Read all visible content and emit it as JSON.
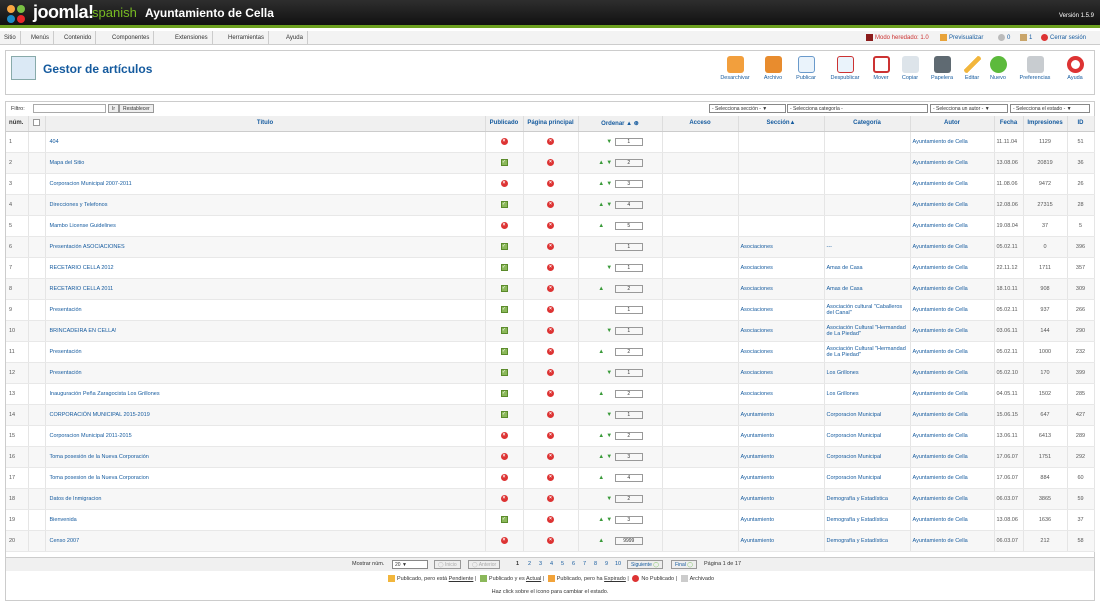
{
  "header": {
    "brand": "joomla!",
    "brand_sub": "spanish",
    "site": "Ayuntamiento de Cella",
    "version": "Versión 1.5.9"
  },
  "menu": [
    "Sitio",
    "Menús",
    "Contenido",
    "Componentes",
    "Extensiones",
    "Herramientas",
    "Ayuda"
  ],
  "status": {
    "legacy": "Modo heredado: 1.0",
    "preview": "Previsualizar",
    "messages": "0",
    "users": "1",
    "logout": "Cerrar sesión"
  },
  "page": {
    "title": "Gestor de artículos"
  },
  "toolbar": [
    "Desarchivar",
    "Archivo",
    "Publicar",
    "Despublicar",
    "Mover",
    "Copiar",
    "Papelera",
    "Editar",
    "Nuevo",
    "Preferencias",
    "Ayuda"
  ],
  "filter": {
    "label": "Filtro:",
    "value": "",
    "go": "Ir",
    "reset": "Restablecer",
    "section": "- Selecciona sección -",
    "category": "- Selecciona categoría -",
    "author": "- Selecciona un autor -",
    "state": "- Selecciona el estado -"
  },
  "columns": [
    "núm.",
    "Título",
    "Publicado",
    "Página principal",
    "Ordenar",
    "Acceso",
    "Sección",
    "Categoría",
    "Autor",
    "Fecha",
    "Impresiones",
    "ID"
  ],
  "rows": [
    {
      "n": "1",
      "t": "404",
      "p": "x",
      "f": "x",
      "up": false,
      "dn": true,
      "o": "1",
      "s": "",
      "c": "",
      "a": "Ayuntamiento de Cella",
      "d": "11.11.04",
      "h": "1129",
      "id": "51"
    },
    {
      "n": "2",
      "t": "Mapa del Sitio",
      "p": "ok",
      "f": "x",
      "up": true,
      "dn": true,
      "o": "2",
      "s": "",
      "c": "",
      "a": "Ayuntamiento de Cella",
      "d": "13.08.06",
      "h": "20819",
      "id": "36"
    },
    {
      "n": "3",
      "t": "Corporacion Municipal 2007-2011",
      "p": "x",
      "f": "x",
      "up": true,
      "dn": true,
      "o": "3",
      "s": "",
      "c": "",
      "a": "Ayuntamiento de Cella",
      "d": "11.08.06",
      "h": "9472",
      "id": "26"
    },
    {
      "n": "4",
      "t": "Direcciones y Telefonos",
      "p": "ok",
      "f": "x",
      "up": true,
      "dn": true,
      "o": "4",
      "s": "",
      "c": "",
      "a": "Ayuntamiento de Cella",
      "d": "12.08.06",
      "h": "27315",
      "id": "28"
    },
    {
      "n": "5",
      "t": "Mambo License Guidelines",
      "p": "x",
      "f": "x",
      "up": true,
      "dn": false,
      "o": "5",
      "s": "",
      "c": "",
      "a": "Ayuntamiento de Cella",
      "d": "19.08.04",
      "h": "37",
      "id": "5"
    },
    {
      "n": "6",
      "t": "Presentación ASOCIACIONES",
      "p": "ok",
      "f": "x",
      "up": false,
      "dn": false,
      "o": "1",
      "s": "Asociaciones",
      "c": "---",
      "a": "Ayuntamiento de Cella",
      "d": "05.02.11",
      "h": "0",
      "id": "396"
    },
    {
      "n": "7",
      "t": "RECETARIO CELLA 2012",
      "p": "ok",
      "f": "x",
      "up": false,
      "dn": true,
      "o": "1",
      "s": "Asociaciones",
      "c": "Amas de Casa",
      "a": "Ayuntamiento de Cella",
      "d": "22.11.12",
      "h": "1711",
      "id": "357"
    },
    {
      "n": "8",
      "t": "RECETARIO CELLA 2011",
      "p": "ok",
      "f": "x",
      "up": true,
      "dn": false,
      "o": "2",
      "s": "Asociaciones",
      "c": "Amas de Casa",
      "a": "Ayuntamiento de Cella",
      "d": "18.10.11",
      "h": "908",
      "id": "309"
    },
    {
      "n": "9",
      "t": "Presentación",
      "p": "ok",
      "f": "x",
      "up": false,
      "dn": false,
      "o": "1",
      "s": "Asociaciones",
      "c": "Asociación cultural \"Caballeros del Canal\"",
      "a": "Ayuntamiento de Cella",
      "d": "05.02.11",
      "h": "937",
      "id": "266"
    },
    {
      "n": "10",
      "t": "BRINCADEIRA EN CELLA!",
      "p": "ok",
      "f": "x",
      "up": false,
      "dn": true,
      "o": "1",
      "s": "Asociaciones",
      "c": "Asociación Cultural \"Hermandad de La Piedad\"",
      "a": "Ayuntamiento de Cella",
      "d": "03.06.11",
      "h": "144",
      "id": "290"
    },
    {
      "n": "11",
      "t": "Presentación",
      "p": "ok",
      "f": "x",
      "up": true,
      "dn": false,
      "o": "2",
      "s": "Asociaciones",
      "c": "Asociación Cultural \"Hermandad de La Piedad\"",
      "a": "Ayuntamiento de Cella",
      "d": "05.02.11",
      "h": "1000",
      "id": "232"
    },
    {
      "n": "12",
      "t": "Presentación",
      "p": "ok",
      "f": "x",
      "up": false,
      "dn": true,
      "o": "1",
      "s": "Asociaciones",
      "c": "Los Grillones",
      "a": "Ayuntamiento de Cella",
      "d": "05.02.10",
      "h": "170",
      "id": "399"
    },
    {
      "n": "13",
      "t": "Inauguración Peña Zaragocista Los Grillones",
      "p": "ok",
      "f": "x",
      "up": true,
      "dn": false,
      "o": "2",
      "s": "Asociaciones",
      "c": "Los Grillones",
      "a": "Ayuntamiento de Cella",
      "d": "04.05.11",
      "h": "1502",
      "id": "285"
    },
    {
      "n": "14",
      "t": "CORPORACIÓN MUNICIPAL 2015-2019",
      "p": "ok",
      "f": "x",
      "up": false,
      "dn": true,
      "o": "1",
      "s": "Ayuntamiento",
      "c": "Corporacion Municipal",
      "a": "Ayuntamiento de Cella",
      "d": "15.06.15",
      "h": "647",
      "id": "427"
    },
    {
      "n": "15",
      "t": "Corporacion Municipal 2011-2015",
      "p": "x",
      "f": "x",
      "up": true,
      "dn": true,
      "o": "2",
      "s": "Ayuntamiento",
      "c": "Corporacion Municipal",
      "a": "Ayuntamiento de Cella",
      "d": "13.06.11",
      "h": "6413",
      "id": "289"
    },
    {
      "n": "16",
      "t": "Toma posesión de la Nueva Corporación",
      "p": "x",
      "f": "x",
      "up": true,
      "dn": true,
      "o": "3",
      "s": "Ayuntamiento",
      "c": "Corporacion Municipal",
      "a": "Ayuntamiento de Cella",
      "d": "17.06.07",
      "h": "1751",
      "id": "292"
    },
    {
      "n": "17",
      "t": "Toma posesion de la Nueva Corporacion",
      "p": "x",
      "f": "x",
      "up": true,
      "dn": false,
      "o": "4",
      "s": "Ayuntamiento",
      "c": "Corporacion Municipal",
      "a": "Ayuntamiento de Cella",
      "d": "17.06.07",
      "h": "884",
      "id": "60"
    },
    {
      "n": "18",
      "t": "Datos de Inmigracion",
      "p": "x",
      "f": "x",
      "up": false,
      "dn": true,
      "o": "2",
      "s": "Ayuntamiento",
      "c": "Demografía y Estadística",
      "a": "Ayuntamiento de Cella",
      "d": "06.03.07",
      "h": "3865",
      "id": "59"
    },
    {
      "n": "19",
      "t": "Bienvenida",
      "p": "ok",
      "f": "x",
      "up": true,
      "dn": true,
      "o": "3",
      "s": "Ayuntamiento",
      "c": "Demografía y Estadística",
      "a": "Ayuntamiento de Cella",
      "d": "13.08.06",
      "h": "1636",
      "id": "37"
    },
    {
      "n": "20",
      "t": "Censo 2007",
      "p": "x",
      "f": "x",
      "up": true,
      "dn": false,
      "o": "9999",
      "s": "Ayuntamiento",
      "c": "Demografía y Estadística",
      "a": "Ayuntamiento de Cella",
      "d": "06.03.07",
      "h": "212",
      "id": "58"
    }
  ],
  "pager": {
    "show": "Mostrar núm.",
    "limit": "20",
    "start": "Inicio",
    "prev": "Anterior",
    "pages": [
      "1",
      "2",
      "3",
      "4",
      "5",
      "6",
      "7",
      "8",
      "9",
      "10"
    ],
    "next": "Siguiente",
    "end": "Final",
    "info": "Página 1 de 17"
  },
  "legend": {
    "pending": "Publicado, pero está",
    "pending_w": "Pendiente",
    "current": "Publicado y es",
    "current_w": "Actual",
    "expired": "Publicado, pero ha",
    "expired_w": "Expirado",
    "unpub": "No Publicado",
    "arch": "Archivado",
    "help": "Haz click sobre el icono para cambiar el estado."
  }
}
